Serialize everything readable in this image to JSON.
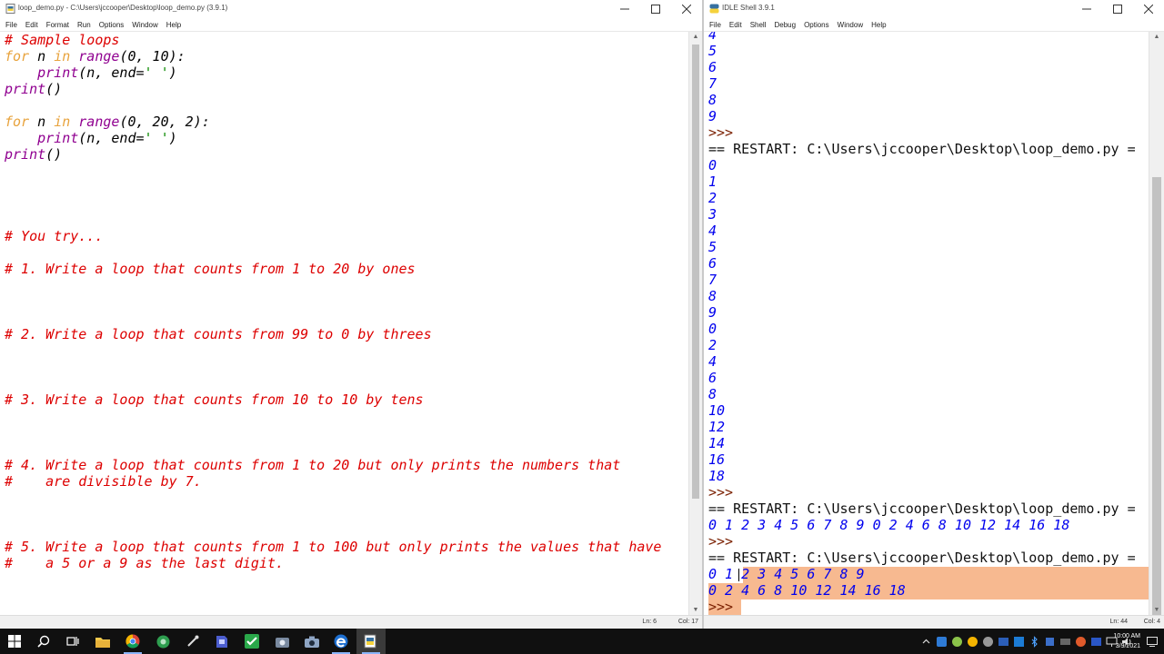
{
  "editor": {
    "title": "loop_demo.py - C:\\Users\\jccooper\\Desktop\\loop_demo.py (3.9.1)",
    "menu": [
      "File",
      "Edit",
      "Format",
      "Run",
      "Options",
      "Window",
      "Help"
    ],
    "lines": [
      [
        {
          "t": "# Sample loops",
          "c": "cm"
        }
      ],
      [
        {
          "t": "for",
          "c": "kw"
        },
        {
          "t": " n ",
          "c": "pl"
        },
        {
          "t": "in",
          "c": "kw"
        },
        {
          "t": " ",
          "c": "pl"
        },
        {
          "t": "range",
          "c": "bi"
        },
        {
          "t": "(0, 10):",
          "c": "pl"
        }
      ],
      [
        {
          "t": "    ",
          "c": "pl"
        },
        {
          "t": "print",
          "c": "bi"
        },
        {
          "t": "(n, end=",
          "c": "pl"
        },
        {
          "t": "' '",
          "c": "st"
        },
        {
          "t": ")",
          "c": "pl"
        }
      ],
      [
        {
          "t": "print",
          "c": "bi"
        },
        {
          "t": "()",
          "c": "pl"
        }
      ],
      [],
      [
        {
          "t": "for",
          "c": "kw"
        },
        {
          "t": " n ",
          "c": "pl"
        },
        {
          "t": "in",
          "c": "kw"
        },
        {
          "t": " ",
          "c": "pl"
        },
        {
          "t": "range",
          "c": "bi"
        },
        {
          "t": "(0, 20, 2):",
          "c": "pl"
        }
      ],
      [
        {
          "t": "    ",
          "c": "pl"
        },
        {
          "t": "print",
          "c": "bi"
        },
        {
          "t": "(n, end=",
          "c": "pl"
        },
        {
          "t": "' '",
          "c": "st"
        },
        {
          "t": ")",
          "c": "pl"
        }
      ],
      [
        {
          "t": "print",
          "c": "bi"
        },
        {
          "t": "()",
          "c": "pl"
        }
      ],
      [],
      [],
      [],
      [],
      [
        {
          "t": "# You try...",
          "c": "cm"
        }
      ],
      [],
      [
        {
          "t": "# 1. Write a loop that counts from 1 to 20 by ones",
          "c": "cm"
        }
      ],
      [],
      [],
      [],
      [
        {
          "t": "# 2. Write a loop that counts from 99 to 0 by threes",
          "c": "cm"
        }
      ],
      [],
      [],
      [],
      [
        {
          "t": "# 3. Write a loop that counts from 10 to 10 by tens",
          "c": "cm"
        }
      ],
      [],
      [],
      [],
      [
        {
          "t": "# 4. Write a loop that counts from 1 to 20 but only prints the numbers that",
          "c": "cm"
        }
      ],
      [
        {
          "t": "#    are divisible by 7.",
          "c": "cm"
        }
      ],
      [],
      [],
      [],
      [
        {
          "t": "# 5. Write a loop that counts from 1 to 100 but only prints the values that have",
          "c": "cm"
        }
      ],
      [
        {
          "t": "#    a 5 or a 9 as the last digit.",
          "c": "cm"
        }
      ]
    ],
    "status": {
      "ln": "Ln: 6",
      "col": "Col: 17"
    }
  },
  "shell": {
    "title": "IDLE Shell 3.9.1",
    "menu": [
      "File",
      "Edit",
      "Shell",
      "Debug",
      "Options",
      "Window",
      "Help"
    ],
    "lines": [
      [
        {
          "t": "4",
          "c": "op"
        }
      ],
      [
        {
          "t": "5",
          "c": "op"
        }
      ],
      [
        {
          "t": "6",
          "c": "op"
        }
      ],
      [
        {
          "t": "7",
          "c": "op"
        }
      ],
      [
        {
          "t": "8",
          "c": "op"
        }
      ],
      [
        {
          "t": "9",
          "c": "op"
        }
      ],
      [
        {
          "t": ">>> ",
          "c": "pr"
        }
      ],
      [
        {
          "t": "== RESTART: C:\\Users\\jccooper\\Desktop\\loop_demo.py =",
          "c": "rs"
        }
      ],
      [
        {
          "t": "0",
          "c": "op"
        }
      ],
      [
        {
          "t": "1",
          "c": "op"
        }
      ],
      [
        {
          "t": "2",
          "c": "op"
        }
      ],
      [
        {
          "t": "3",
          "c": "op"
        }
      ],
      [
        {
          "t": "4",
          "c": "op"
        }
      ],
      [
        {
          "t": "5",
          "c": "op"
        }
      ],
      [
        {
          "t": "6",
          "c": "op"
        }
      ],
      [
        {
          "t": "7",
          "c": "op"
        }
      ],
      [
        {
          "t": "8",
          "c": "op"
        }
      ],
      [
        {
          "t": "9",
          "c": "op"
        }
      ],
      [
        {
          "t": "0",
          "c": "op"
        }
      ],
      [
        {
          "t": "2",
          "c": "op"
        }
      ],
      [
        {
          "t": "4",
          "c": "op"
        }
      ],
      [
        {
          "t": "6",
          "c": "op"
        }
      ],
      [
        {
          "t": "8",
          "c": "op"
        }
      ],
      [
        {
          "t": "10",
          "c": "op"
        }
      ],
      [
        {
          "t": "12",
          "c": "op"
        }
      ],
      [
        {
          "t": "14",
          "c": "op"
        }
      ],
      [
        {
          "t": "16",
          "c": "op"
        }
      ],
      [
        {
          "t": "18",
          "c": "op"
        }
      ],
      [
        {
          "t": ">>> ",
          "c": "pr"
        }
      ],
      [
        {
          "t": "== RESTART: C:\\Users\\jccooper\\Desktop\\loop_demo.py =",
          "c": "rs"
        }
      ],
      [
        {
          "t": "0 1 2 3 4 5 6 7 8 9 0 2 4 6 8 10 12 14 16 18",
          "c": "op"
        }
      ],
      [
        {
          "t": ">>> ",
          "c": "pr"
        }
      ],
      [
        {
          "t": "== RESTART: C:\\Users\\jccooper\\Desktop\\loop_demo.py =",
          "c": "rs"
        }
      ],
      [
        {
          "t": "0 1 2 3 4 5 6 7 8 9",
          "c": "op"
        }
      ],
      [
        {
          "t": "0 2 4 6 8 10 12 14 16 18",
          "c": "op"
        }
      ],
      [
        {
          "t": ">>> ",
          "c": "pr"
        }
      ]
    ],
    "status": {
      "ln": "Ln: 44",
      "col": "Col: 4"
    }
  },
  "taskbar": {
    "apps": [
      "windows-start",
      "search",
      "task-view",
      "file-explorer",
      "chrome",
      "app-green",
      "app-tool",
      "app-blue",
      "checkmark-app",
      "app-grey",
      "camera",
      "edge",
      "idle"
    ],
    "clock": {
      "time": "10:00 AM",
      "date": "3/9/2021"
    }
  },
  "colors": {
    "selection": "#f7b990",
    "prompt": "#7a1f00",
    "output": "#0000ee",
    "comment": "#dd0000",
    "keyword": "#e8a33d",
    "builtin": "#900090",
    "string": "#0a8a00"
  }
}
